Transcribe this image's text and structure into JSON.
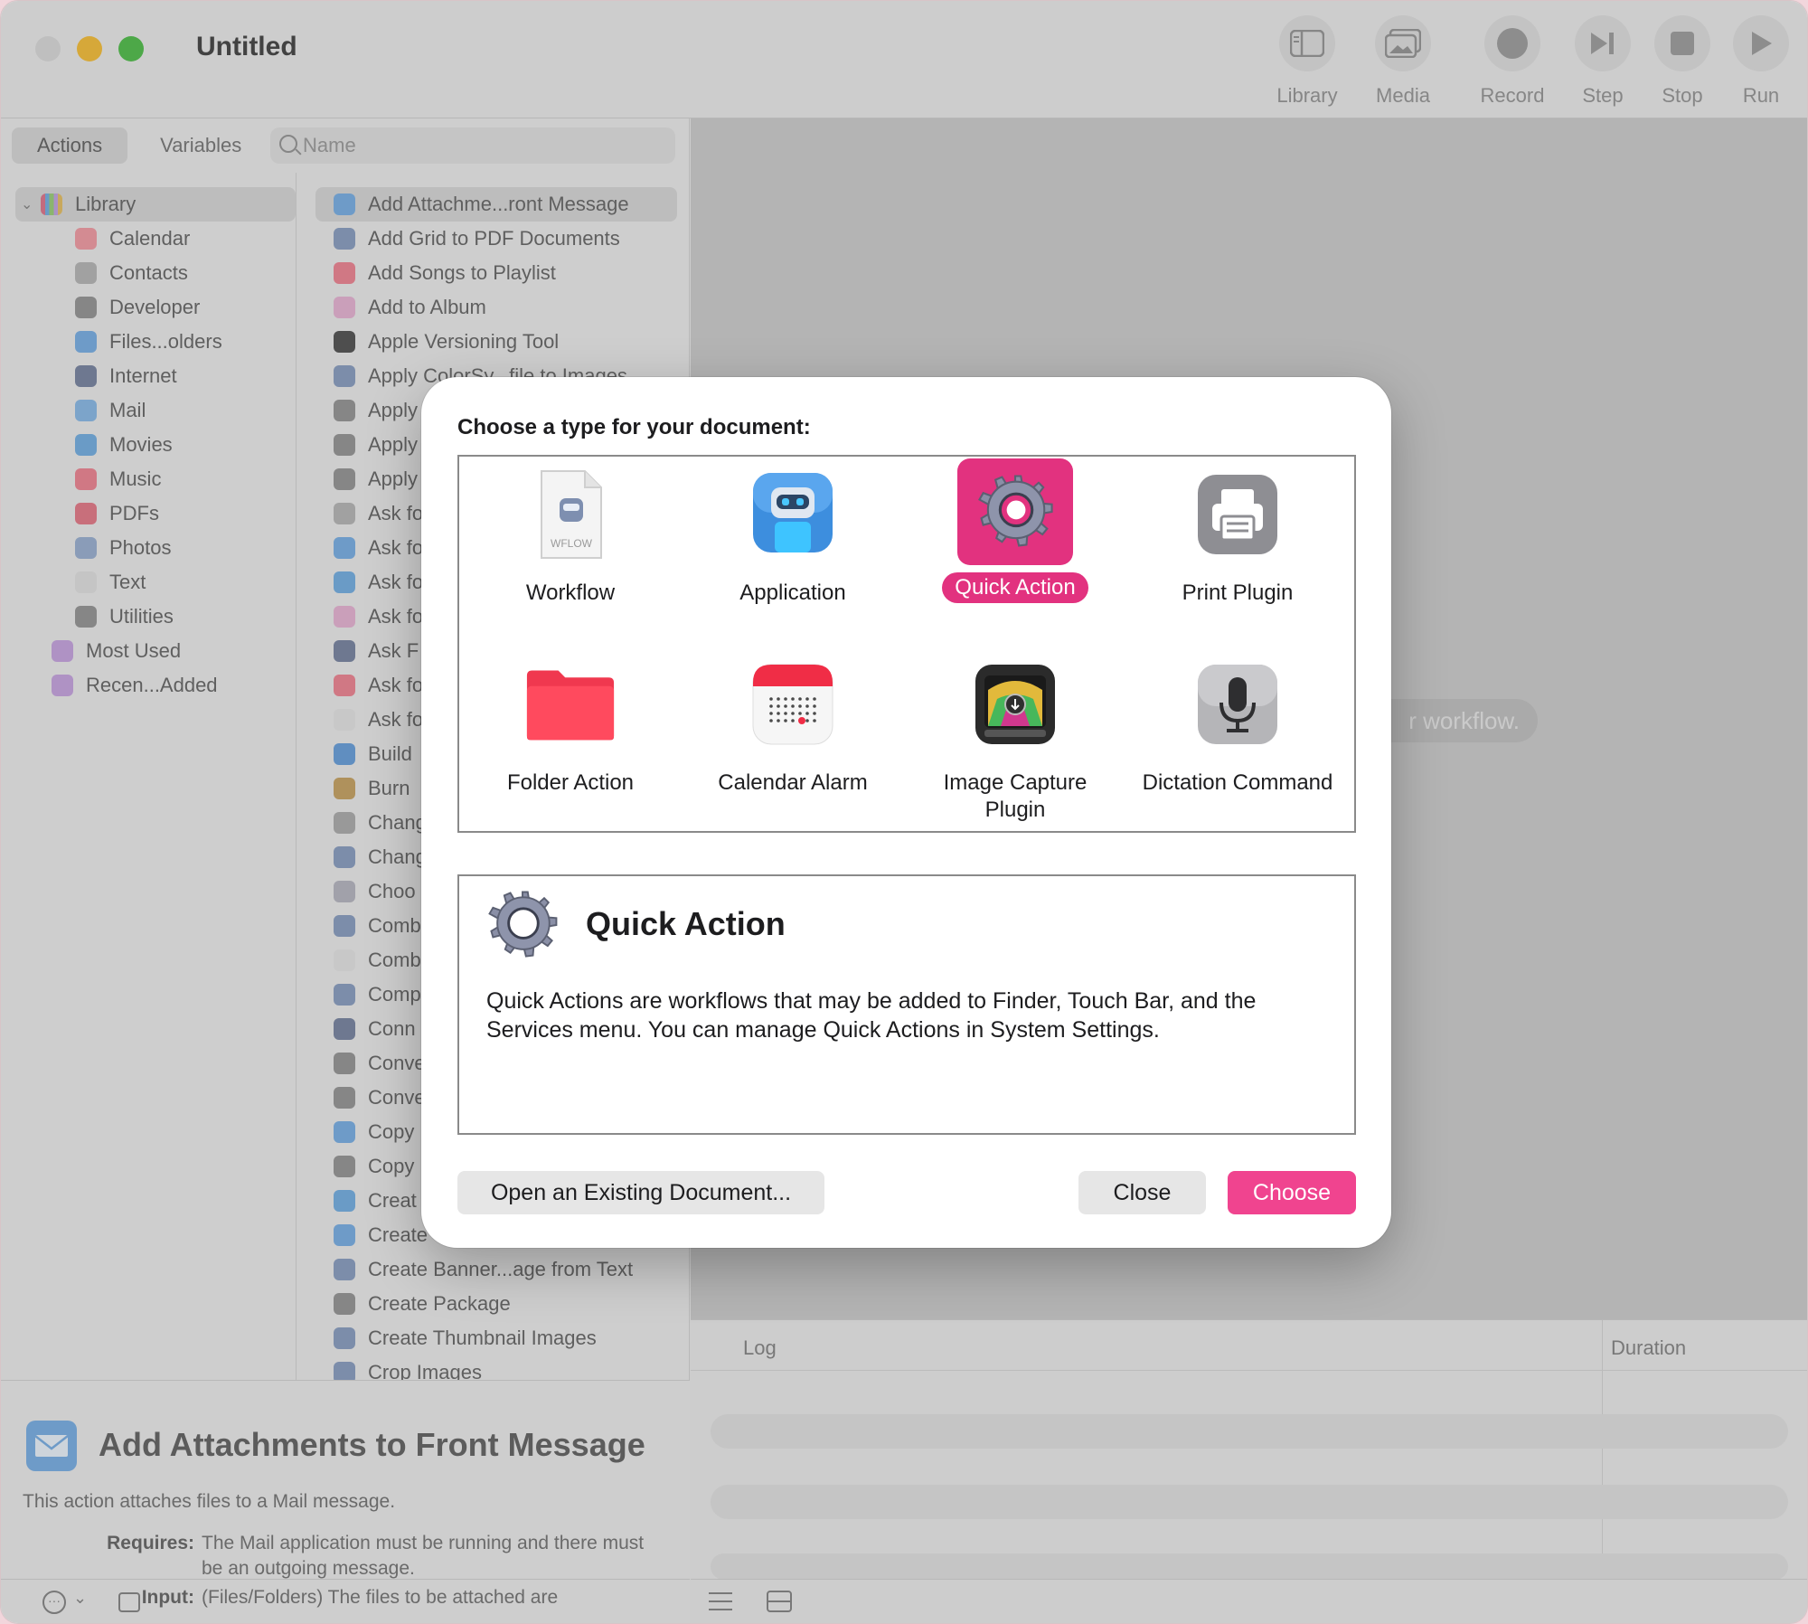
{
  "window": {
    "title": "Untitled"
  },
  "toolbar": {
    "library": "Library",
    "media": "Media",
    "record": "Record",
    "step": "Step",
    "stop": "Stop",
    "run": "Run"
  },
  "left_tabs": {
    "actions": "Actions",
    "variables": "Variables"
  },
  "search": {
    "placeholder": "Name"
  },
  "library": {
    "root": "Library",
    "items": [
      "Calendar",
      "Contacts",
      "Developer",
      "Files...olders",
      "Internet",
      "Mail",
      "Movies",
      "Music",
      "PDFs",
      "Photos",
      "Text",
      "Utilities"
    ],
    "extra": [
      "Most Used",
      "Recen...Added"
    ]
  },
  "actions_list": [
    "Add Attachme...ront Message",
    "Add Grid to PDF Documents",
    "Add Songs to Playlist",
    "Add to Album",
    "Apple Versioning Tool",
    "Apply ColorSy...file to Images",
    "Apply",
    "Apply",
    "Apply",
    "Ask fo",
    "Ask fo",
    "Ask fo",
    "Ask fo",
    "Ask F",
    "Ask fo",
    "Ask fo",
    "Build",
    "Burn",
    "Chang",
    "Chang",
    "Choo",
    "Comb",
    "Comb",
    "Comp",
    "Conn",
    "Conve",
    "Conve",
    "Copy",
    "Copy",
    "Creat",
    "Create",
    "Create Banner...age from Text",
    "Create Package",
    "Create Thumbnail Images",
    "Crop Images"
  ],
  "detail": {
    "title": "Add Attachments to Front Message",
    "description": "This action attaches files to a Mail message.",
    "requires_label": "Requires:",
    "requires_text": "The Mail application must be running and there must be an outgoing message.",
    "input_label": "Input:",
    "input_text": "(Files/Folders) The files to be attached are"
  },
  "canvas": {
    "hint": "r workflow."
  },
  "log": {
    "col_log": "Log",
    "col_duration": "Duration"
  },
  "dialog": {
    "title": "Choose a type for your document:",
    "types": [
      {
        "label": "Workflow",
        "icon": "workflow-file-icon"
      },
      {
        "label": "Application",
        "icon": "automator-robot-icon"
      },
      {
        "label": "Quick Action",
        "icon": "gear-icon",
        "selected": true
      },
      {
        "label": "Print Plugin",
        "icon": "printer-icon"
      },
      {
        "label": "Folder Action",
        "icon": "folder-icon"
      },
      {
        "label": "Calendar Alarm",
        "icon": "calendar-icon"
      },
      {
        "label": "Image Capture Plugin",
        "icon": "image-capture-icon"
      },
      {
        "label": "Dictation Command",
        "icon": "microphone-icon"
      }
    ],
    "wflow_text": "WFLOW",
    "selected_title": "Quick Action",
    "selected_description": "Quick Actions are workflows that may be added to Finder, Touch Bar, and the Services menu. You can manage Quick Actions in System Settings.",
    "buttons": {
      "open": "Open an Existing Document...",
      "close": "Close",
      "choose": "Choose"
    }
  },
  "colors": {
    "accent": "#f0448f",
    "selection": "#e2327f"
  }
}
